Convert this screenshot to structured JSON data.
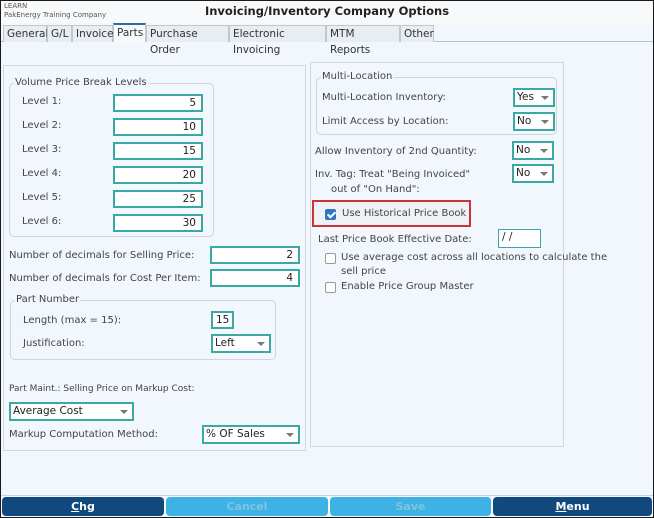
{
  "titlebar": {
    "env": "LEARN",
    "company": "PakEnergy Training Company",
    "title": "Invoicing/Inventory Company Options"
  },
  "tabs": [
    {
      "label": "General",
      "active": false
    },
    {
      "label": "G/L",
      "active": false
    },
    {
      "label": "Invoice",
      "active": false
    },
    {
      "label": "Parts",
      "active": true
    },
    {
      "label": "Purchase Order",
      "active": false
    },
    {
      "label": "Electronic Invoicing",
      "active": false
    },
    {
      "label": "MTM Reports",
      "active": false
    },
    {
      "label": "Other",
      "active": false
    }
  ],
  "left": {
    "volume_group_title": "Volume Price Break Levels",
    "levels": [
      {
        "label": "Level 1:",
        "value": "5"
      },
      {
        "label": "Level 2:",
        "value": "10"
      },
      {
        "label": "Level 3:",
        "value": "15"
      },
      {
        "label": "Level 4:",
        "value": "20"
      },
      {
        "label": "Level 5:",
        "value": "25"
      },
      {
        "label": "Level 6:",
        "value": "30"
      }
    ],
    "decimals_selling_label": "Number of decimals for Selling Price:",
    "decimals_selling_value": "2",
    "decimals_cost_label": "Number of decimals for Cost Per Item:",
    "decimals_cost_value": "4",
    "part_number_title": "Part Number",
    "length_label": "Length (max = 15):",
    "length_value": "15",
    "justification_label": "Justification:",
    "justification_value": "Left",
    "markup_cost_label": "Part Maint.:  Selling Price on Markup Cost:",
    "markup_cost_value": "Average Cost",
    "markup_method_label": "Markup Computation Method:",
    "markup_method_value": "% OF Sales"
  },
  "right": {
    "multi_location_title": "Multi-Location",
    "multi_location_inventory_label": "Multi-Location Inventory:",
    "multi_location_inventory_value": "Yes",
    "limit_access_label": "Limit Access by Location:",
    "limit_access_value": "No",
    "allow_2nd_qty_label": "Allow Inventory of 2nd Quantity:",
    "allow_2nd_qty_value": "No",
    "inv_tag_label_1": "Inv. Tag: Treat \"Being Invoiced\"",
    "inv_tag_label_2": "out of \"On Hand\":",
    "inv_tag_value": "No",
    "historical_price_book_label": "Use Historical Price Book",
    "historical_price_book_checked": true,
    "last_price_book_label": "Last Price Book Effective Date:",
    "last_price_book_value": " /  /",
    "avg_cost_label_1": "Use average cost across all locations to calculate the",
    "avg_cost_label_2": "sell price",
    "avg_cost_checked": false,
    "price_group_label": "Enable Price Group Master",
    "price_group_checked": false
  },
  "buttons": {
    "chg": {
      "first": "C",
      "rest": "hg"
    },
    "cancel": "Cancel",
    "save": "Save",
    "menu": {
      "first": "M",
      "rest": "enu"
    }
  },
  "colors": {
    "accent_border": "#3aa9a3",
    "primary_button": "#11487e",
    "disabled_button": "#3eb2e4",
    "highlight": "#c9343b",
    "checkbox_checked": "#2f74c6"
  }
}
